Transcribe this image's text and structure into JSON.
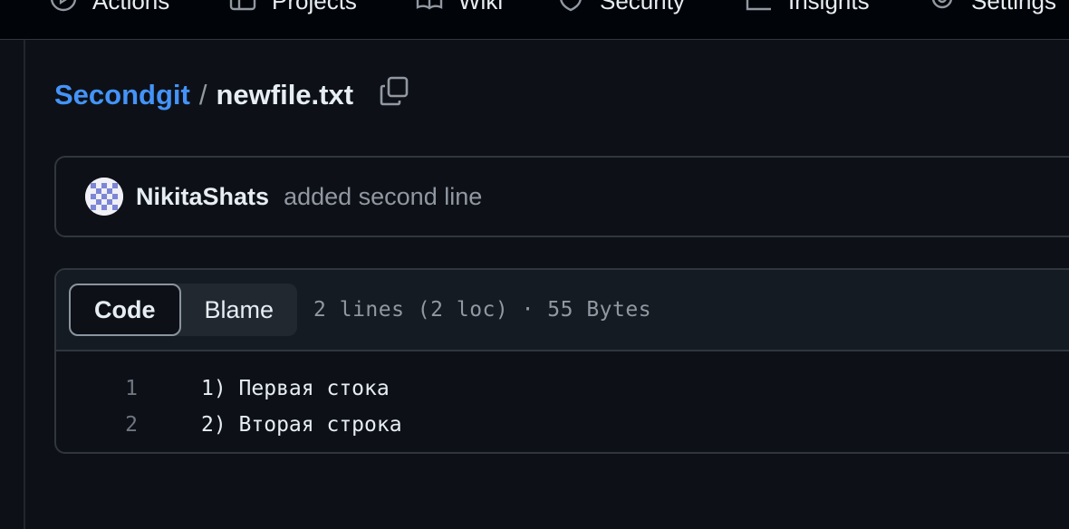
{
  "nav": {
    "items": [
      {
        "label": "Actions",
        "icon": "play-circle-icon"
      },
      {
        "label": "Projects",
        "icon": "table-icon"
      },
      {
        "label": "Wiki",
        "icon": "book-icon"
      },
      {
        "label": "Security",
        "icon": "shield-icon"
      },
      {
        "label": "Insights",
        "icon": "graph-icon"
      },
      {
        "label": "Settings",
        "icon": "gear-icon"
      }
    ]
  },
  "breadcrumb": {
    "repo": "Secondgit",
    "separator": "/",
    "file": "newfile.txt"
  },
  "commit": {
    "author": "NikitaShats",
    "message": "added second line"
  },
  "file": {
    "tabs": {
      "code": "Code",
      "blame": "Blame"
    },
    "meta": "2 lines (2 loc) · 55 Bytes",
    "lines": [
      {
        "number": "1",
        "text": "1) Первая стока"
      },
      {
        "number": "2",
        "text": "2) Вторая строка"
      }
    ]
  },
  "colors": {
    "background": "#0d1117",
    "accent_link": "#4493f8",
    "border": "#30363d",
    "muted_text": "#9198a1"
  }
}
